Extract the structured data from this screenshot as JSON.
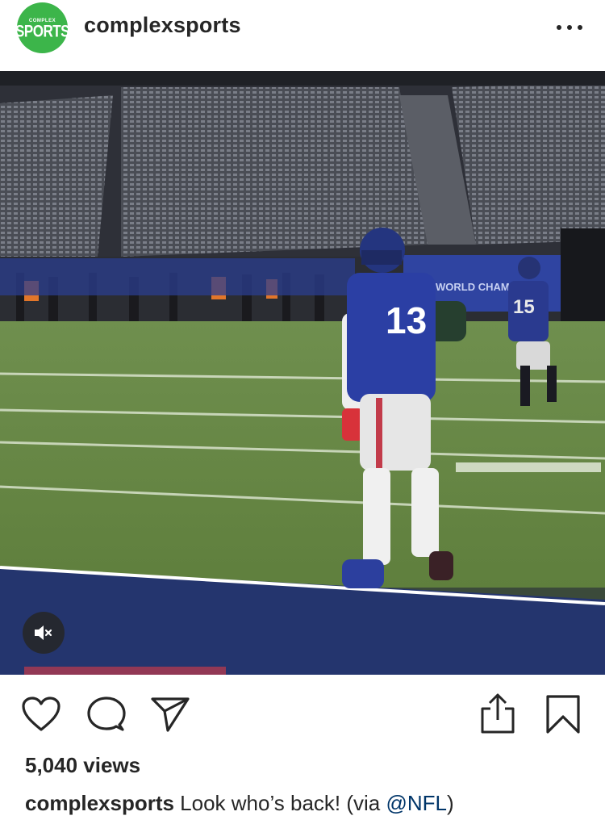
{
  "post": {
    "account": {
      "username": "complexsports",
      "avatar_top_text": "COMPLEX",
      "avatar_main_text": "SPORTS",
      "avatar_color": "#3cb54a"
    },
    "more_icon": "more-horizontal-icon",
    "media": {
      "type": "video",
      "jersey_number_front": "13",
      "jersey_number_back": "15",
      "banner_text": "WORLD CHAMPI",
      "muted": true,
      "mute_icon": "speaker-muted-icon"
    },
    "actions": {
      "icons": [
        "heart-icon",
        "comment-icon",
        "share-paper-plane-icon",
        "upload-icon",
        "bookmark-icon"
      ]
    },
    "views": "5,040 views",
    "caption": {
      "username": "complexsports",
      "text_before": " Look who’s back! (via ",
      "mention": "@NFL",
      "text_after": ")"
    }
  }
}
